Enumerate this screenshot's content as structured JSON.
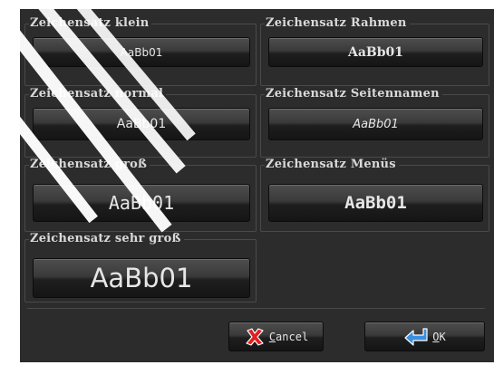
{
  "groups": [
    {
      "title": "Zeichensatz klein",
      "sample": "AaBb01"
    },
    {
      "title": "Zeichensatz Rahmen",
      "sample": "AaBb01"
    },
    {
      "title": "Zeichensatz normal",
      "sample": "AaBb01"
    },
    {
      "title": "Zeichensatz Seitennamen",
      "sample": "AaBb01"
    },
    {
      "title": "Zeichensatz groß",
      "sample": "AaBb01"
    },
    {
      "title": "Zeichensatz Menüs",
      "sample": "AaBb01"
    },
    {
      "title": "Zeichensatz sehr groß",
      "sample": "AaBb01"
    }
  ],
  "buttons": {
    "cancel": {
      "mnemonic": "C",
      "rest": "ancel",
      "icon": "red-x-icon"
    },
    "ok": {
      "mnemonic": "O",
      "rest": "K",
      "icon": "blue-return-arrow-icon"
    }
  },
  "colors": {
    "background": "#2c2c2c",
    "text": "#e6e6e6",
    "cancel_icon": "#e02020",
    "ok_icon": "#3a8fe0"
  }
}
